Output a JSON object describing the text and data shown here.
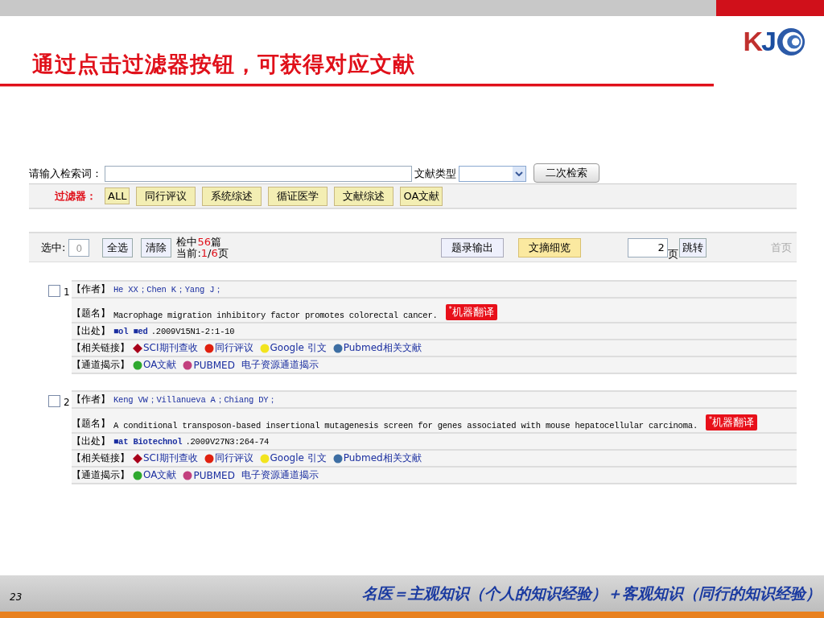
{
  "slide": {
    "title": "通过点击过滤器按钮，可获得对应文献",
    "logo": "KJ",
    "page_number": "23",
    "footer_text": "名医＝主观知识（个人的知识经验）＋客观知识（同行的知识经验）"
  },
  "search": {
    "label": "请输入检索词：",
    "doc_type_label": "文献类型",
    "secondary_search_button": "二次检索"
  },
  "filters": {
    "label": "过滤器：",
    "buttons": [
      "ALL",
      "同行评议",
      "系统综述",
      "循证医学",
      "文献综述",
      "OA文献"
    ]
  },
  "toolbar": {
    "selected_label": "选中:",
    "selected_count": "0",
    "select_all": "全选",
    "clear": "清除",
    "found_label": "检中",
    "found_count": "56",
    "found_unit": "篇",
    "page_label": "当前:",
    "page_current": "1",
    "page_sep": "/",
    "page_total": "6",
    "page_unit": "页",
    "views": [
      {
        "label": "题录输出",
        "selected": false
      },
      {
        "label": "文摘细览",
        "selected": true
      }
    ],
    "page_input": "2",
    "page_input_unit": "页",
    "jump_button": "跳转",
    "first_page": "首页"
  },
  "records": [
    {
      "number": "1",
      "checked": false,
      "author_label": "【作者】",
      "authors": "He XX；Chen K；Yang J；",
      "title_label": "【题名】",
      "title": "Macrophage migration inhibitory factor promotes colorectal cancer.",
      "translate_badge": "$^{*}$机器翻译",
      "source_label": "【出处】",
      "journal": "■ol ■ed",
      "source_detail": " .2009V15N1-2:1-10",
      "links_label": "【相关链接】",
      "links": [
        {
          "kind": "diamond",
          "color": "#a8001a",
          "label": "SCI期刊查收"
        },
        {
          "kind": "dot",
          "color": "#e0200e",
          "label": "同行评议"
        },
        {
          "kind": "dot",
          "color": "#f2e41e",
          "label": "Google 引文"
        },
        {
          "kind": "dot",
          "color": "#3d6ea3",
          "label": "Pubmed相关文献"
        }
      ],
      "channels_label": "【通道揭示】",
      "channels": [
        {
          "kind": "dot",
          "color": "#2ea82e",
          "label": "OA文献"
        },
        {
          "kind": "dot",
          "color": "#c2407e",
          "label": "PUBMED"
        },
        {
          "kind": "plain",
          "label": "电子资源通道揭示"
        }
      ]
    },
    {
      "number": "2",
      "checked": false,
      "author_label": "【作者】",
      "authors": "Keng VW；Villanueva A；Chiang DY；",
      "title_label": "【题名】",
      "title": "A conditional transposon-based insertional mutagenesis screen for genes associated with mouse hepatocellular carcinoma.",
      "translate_badge": "$^{*}$机器翻译",
      "source_label": "【出处】",
      "journal": "■at Biotechnol",
      "source_detail": " .2009V27N3:264-74",
      "links_label": "【相关链接】",
      "links": [
        {
          "kind": "diamond",
          "color": "#a8001a",
          "label": "SCI期刊查收"
        },
        {
          "kind": "dot",
          "color": "#e0200e",
          "label": "同行评议"
        },
        {
          "kind": "dot",
          "color": "#f2e41e",
          "label": "Google 引文"
        },
        {
          "kind": "dot",
          "color": "#3d6ea3",
          "label": "Pubmed相关文献"
        }
      ],
      "channels_label": "【通道揭示】",
      "channels": [
        {
          "kind": "dot",
          "color": "#2ea82e",
          "label": "OA文献"
        },
        {
          "kind": "dot",
          "color": "#c2407e",
          "label": "PUBMED"
        },
        {
          "kind": "plain",
          "label": "电子资源通道揭示"
        }
      ]
    }
  ]
}
